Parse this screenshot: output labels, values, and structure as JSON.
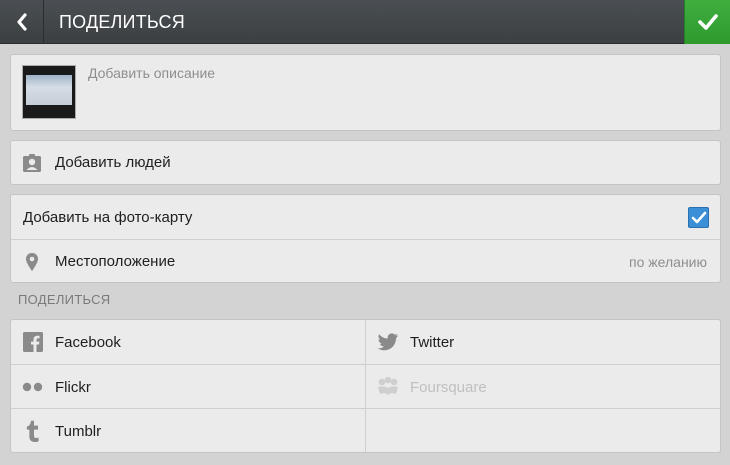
{
  "header": {
    "title": "ПОДЕЛИТЬСЯ",
    "back_icon": "chevron-left-icon",
    "done_icon": "checkmark-icon",
    "accent_color": "#37a537"
  },
  "description": {
    "placeholder": "Добавить описание"
  },
  "people": {
    "label": "Добавить людей",
    "icon": "person-tag-icon"
  },
  "photo_map": {
    "label": "Добавить на фото-карту",
    "checked": true,
    "location_label": "Местоположение",
    "location_hint": "по желанию",
    "location_icon": "map-pin-icon"
  },
  "share": {
    "section_title": "ПОДЕЛИТЬСЯ",
    "services": [
      {
        "label": "Facebook",
        "icon": "facebook-icon",
        "enabled": true
      },
      {
        "label": "Twitter",
        "icon": "twitter-icon",
        "enabled": true
      },
      {
        "label": "Flickr",
        "icon": "flickr-icon",
        "enabled": true
      },
      {
        "label": "Foursquare",
        "icon": "foursquare-icon",
        "enabled": false
      },
      {
        "label": "Tumblr",
        "icon": "tumblr-icon",
        "enabled": true
      }
    ]
  }
}
